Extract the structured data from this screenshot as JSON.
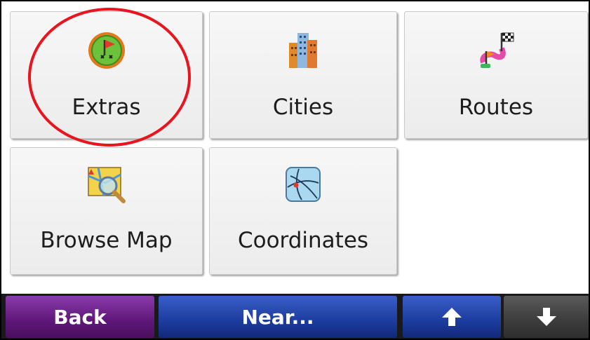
{
  "menu": {
    "items": [
      {
        "label": "Extras",
        "icon": "extras-flag-icon"
      },
      {
        "label": "Cities",
        "icon": "city-buildings-icon"
      },
      {
        "label": "Routes",
        "icon": "route-checkered-flag-icon"
      },
      {
        "label": "Browse Map",
        "icon": "browse-map-magnifier-icon"
      },
      {
        "label": "Coordinates",
        "icon": "coordinates-globe-icon"
      }
    ]
  },
  "annotation": {
    "highlight_color": "#e8141e",
    "highlighted_item": "Extras"
  },
  "bottom_bar": {
    "back_label": "Back",
    "near_label": "Near...",
    "up_icon": "arrow-up-icon",
    "down_icon": "arrow-down-icon"
  },
  "colors": {
    "back": "#5e1778",
    "near": "#1c3c9e",
    "down": "#3c3c3c"
  }
}
